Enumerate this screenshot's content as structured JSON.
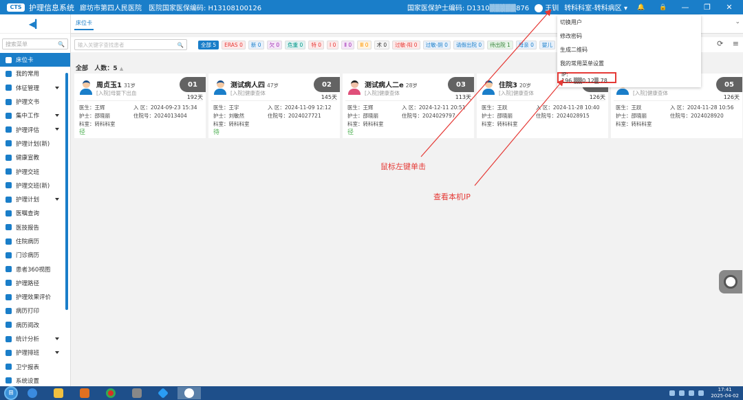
{
  "header": {
    "app_title": "护理信息系统",
    "hospital": "廊坊市第四人民医院",
    "hospital_code": "医院国家医保编码: H13108100126",
    "nurse_code": "国家医保护士编码: D1310▒▒▒▒▒876",
    "user_name": "王钏",
    "ward": "转科科室-转科病区",
    "logo_text": "CTS",
    "minimize": "—",
    "maximize": "❐",
    "close": "✕",
    "bell_icon": "🔔",
    "lock_icon": "🔒"
  },
  "sidebar": {
    "collapse_icon": "◀▎",
    "search_placeholder": "搜索菜单",
    "search_icon": "🔍",
    "items": [
      {
        "label": "床位卡",
        "active": true,
        "arrow": false
      },
      {
        "label": "我的常用",
        "active": false,
        "arrow": false
      },
      {
        "label": "体征管理",
        "active": false,
        "arrow": true
      },
      {
        "label": "护理文书",
        "active": false,
        "arrow": false
      },
      {
        "label": "集中工作",
        "active": false,
        "arrow": true
      },
      {
        "label": "护理评估",
        "active": false,
        "arrow": true
      },
      {
        "label": "护理计划(新)",
        "active": false,
        "arrow": false
      },
      {
        "label": "健康宣教",
        "active": false,
        "arrow": false
      },
      {
        "label": "护理交班",
        "active": false,
        "arrow": false
      },
      {
        "label": "护理交班(新)",
        "active": false,
        "arrow": false
      },
      {
        "label": "护理计划",
        "active": false,
        "arrow": true
      },
      {
        "label": "医嘱查询",
        "active": false,
        "arrow": false
      },
      {
        "label": "医技报告",
        "active": false,
        "arrow": false
      },
      {
        "label": "住院病历",
        "active": false,
        "arrow": false
      },
      {
        "label": "门诊病历",
        "active": false,
        "arrow": false
      },
      {
        "label": "患者360视图",
        "active": false,
        "arrow": false
      },
      {
        "label": "护理路径",
        "active": false,
        "arrow": false
      },
      {
        "label": "护理效果评价",
        "active": false,
        "arrow": false
      },
      {
        "label": "病历打印",
        "active": false,
        "arrow": false
      },
      {
        "label": "病历阅改",
        "active": false,
        "arrow": false
      },
      {
        "label": "统计分析",
        "active": false,
        "arrow": true
      },
      {
        "label": "护理排班",
        "active": false,
        "arrow": true
      },
      {
        "label": "卫宁报表",
        "active": false,
        "arrow": false
      },
      {
        "label": "系统设置",
        "active": false,
        "arrow": false
      }
    ]
  },
  "tabs": {
    "bedcard": "床位卡",
    "menu_icon": "⌄"
  },
  "filter": {
    "search_placeholder": "输入关键字查找患者",
    "chips": [
      "全部 5",
      "ERAS 0",
      "新 0",
      "欠 0",
      "危重 0",
      "特 0",
      "Ⅰ 0",
      "Ⅱ 0",
      "Ⅲ 0",
      "术 0",
      "过敏-阳 0",
      "过敏-阴 0",
      "请假出院 0",
      "待出院 1",
      "母亲 0",
      "婴儿"
    ],
    "chip_colors": [
      "#1a7ec9",
      "#e53935",
      "#1a7ec9",
      "#9c27b0",
      "#009688",
      "#e53935",
      "#e53935",
      "#9c27b0",
      "#ff9800",
      "#333333",
      "#e53935",
      "#1a7ec9",
      "#1a7ec9",
      "#2e7d32",
      "#1a7ec9",
      "#1a7ec9"
    ],
    "chip_bgs": [
      "#1a7ec9",
      "#fde9e9",
      "#e8f1fb",
      "#f5e6f8",
      "#e0f2f1",
      "#fde9e9",
      "#fde9e9",
      "#f5e6f8",
      "#fff3e0",
      "#f5f5f5",
      "#fde9e9",
      "#e8f1fb",
      "#e8f1fb",
      "#e8f5e9",
      "#e8f1fb",
      "#e8f1fb"
    ],
    "refresh_icon": "⟳",
    "more_icon": "≡"
  },
  "summary": {
    "all": "全部",
    "count_label": "人数：5",
    "toggle_icon": "▲"
  },
  "patients": [
    {
      "name": "周贞玉1",
      "age": "31岁",
      "diag": "[入院]母婴下出血",
      "bed": "01",
      "days": "192天",
      "doctor": "医生：王辉",
      "nurse": "护士：邵晓丽",
      "dept": "科室：转科科室",
      "ward": "入  区：2024-09-23 15:34",
      "inpatient": "住院号：2024013404",
      "flag": "径",
      "gender": "m"
    },
    {
      "name": "测试病人四",
      "age": "47岁",
      "diag": "[入院]健康查体",
      "bed": "02",
      "days": "145天",
      "doctor": "医生：王宇",
      "nurse": "护士：刘敏然",
      "dept": "科室：转科科室",
      "ward": "入  区：2024-11-09 12:12",
      "inpatient": "住院号：2024027721",
      "flag": "待",
      "gender": "m"
    },
    {
      "name": "测试病人二e",
      "age": "28岁",
      "diag": "[入院]健康查体",
      "bed": "03",
      "days": "113天",
      "doctor": "医生：王辉",
      "nurse": "护士：邵晓丽",
      "dept": "科室：转科科室",
      "ward": "入  区：2024-12-11 20:51",
      "inpatient": "住院号：2024029797",
      "flag": "径",
      "gender": "f"
    },
    {
      "name": "住院3",
      "age": "20岁",
      "diag": "[入院]健康查体",
      "bed": "04",
      "days": "126天",
      "doctor": "医生：王跃",
      "nurse": "护士：邵晓丽",
      "dept": "科室：转科科室",
      "ward": "入  区：2024-11-28 10:40",
      "inpatient": "住院号：2024028915",
      "flag": "",
      "gender": "m"
    },
    {
      "name": "",
      "age": "",
      "diag": "[入院]健康查体",
      "bed": "05",
      "days": "126天",
      "doctor": "医生：王跃",
      "nurse": "护士：邵晓丽",
      "dept": "科室：转科科室",
      "ward": "入  区：2024-11-28 10:56",
      "inpatient": "住院号：2024028920",
      "flag": "",
      "gender": "m"
    }
  ],
  "dropdown": {
    "items": [
      "切换用户",
      "修改密码",
      "生成二维码",
      "我的常用菜单设置"
    ],
    "ip": "IP: 196.▒▒0.12▒.78"
  },
  "annotations": {
    "left_click": "鼠标左键单击",
    "view_ip": "查看本机IP"
  },
  "taskbar": {
    "time": "17:41",
    "date": "2025-04-02",
    "start_icon": "⊞"
  }
}
